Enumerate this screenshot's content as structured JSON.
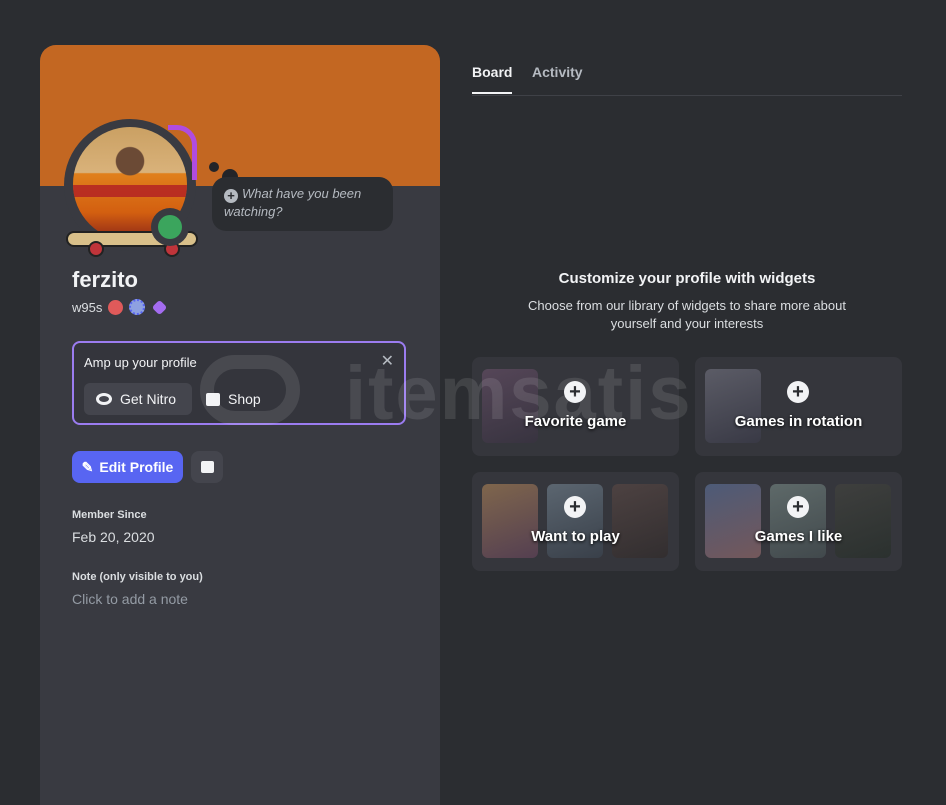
{
  "profile": {
    "display_name": "ferzito",
    "username": "w95s",
    "status_prompt": "What have you been watching?",
    "status_color": "#3ba55d",
    "banner_color": "#c36722"
  },
  "nitro": {
    "title": "Amp up your profile",
    "get_nitro": "Get Nitro",
    "shop": "Shop",
    "close_icon": "close-icon"
  },
  "actions": {
    "edit_profile": "Edit Profile",
    "accent": "#5865f2"
  },
  "member_since": {
    "label": "Member Since",
    "value": "Feb 20, 2020"
  },
  "note": {
    "label": "Note (only visible to you)",
    "placeholder": "Click to add a note"
  },
  "tabs": [
    {
      "label": "Board",
      "active": true
    },
    {
      "label": "Activity",
      "active": false
    }
  ],
  "widgets": {
    "title": "Customize your profile with widgets",
    "subtitle": "Choose from our library of widgets to share more about yourself and your interests",
    "cards": [
      {
        "label": "Favorite game"
      },
      {
        "label": "Games in rotation"
      },
      {
        "label": "Want to play"
      },
      {
        "label": "Games I like"
      }
    ]
  },
  "watermark": "itemsatis"
}
